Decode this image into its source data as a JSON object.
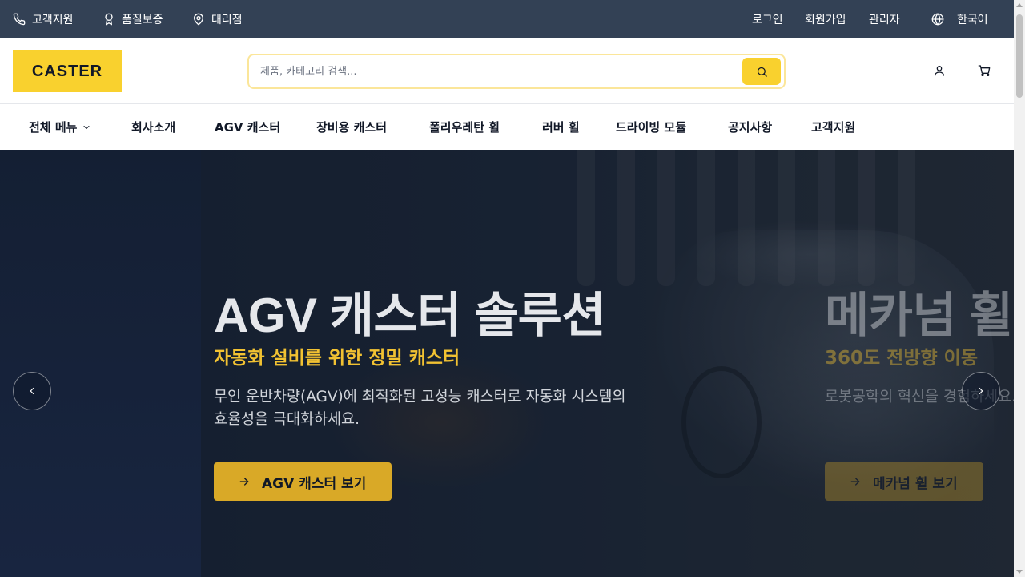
{
  "topbar": {
    "left_links": [
      {
        "label": "고객지원",
        "icon": "phone-icon"
      },
      {
        "label": "품질보증",
        "icon": "award-icon"
      },
      {
        "label": "대리점",
        "icon": "map-pin-icon"
      }
    ],
    "right_links": [
      "로그인",
      "회원가입",
      "관리자"
    ],
    "language": {
      "label": "한국어",
      "icon": "globe-icon"
    }
  },
  "header": {
    "logo": "CASTER",
    "search": {
      "placeholder": "제품, 카테고리 검색...",
      "value": ""
    },
    "icons": [
      "user-icon",
      "cart-icon"
    ]
  },
  "nav": {
    "all_menu": "전체 메뉴",
    "items": [
      "회사소개",
      "AGV 캐스터",
      "장비용 캐스터",
      "폴리우레탄 휠",
      "러버 휠",
      "드라이빙 모듈",
      "공지사항",
      "고객지원"
    ]
  },
  "hero": {
    "slides": [
      {
        "title": "AGV 캐스터 솔루션",
        "subtitle": "자동화 설비를 위한 정밀 캐스터",
        "description": "무인 운반차량(AGV)에 최적화된 고성능 캐스터로 자동화 시스템의 효율성을 극대화하세요.",
        "cta": "AGV 캐스터 보기"
      },
      {
        "title": "메카넘 휠",
        "subtitle": "360도 전방향 이동",
        "description": "로봇공학의 혁신을 경험하세요. 완전한 이동의 자유를 경험하세요.",
        "cta": "메카넘 휠 보기"
      }
    ]
  },
  "colors": {
    "topbar": "#334155",
    "brand_yellow": "#f9d12e",
    "cta_gold": "#d9a927",
    "hero_dark": "#0f1a2c"
  }
}
